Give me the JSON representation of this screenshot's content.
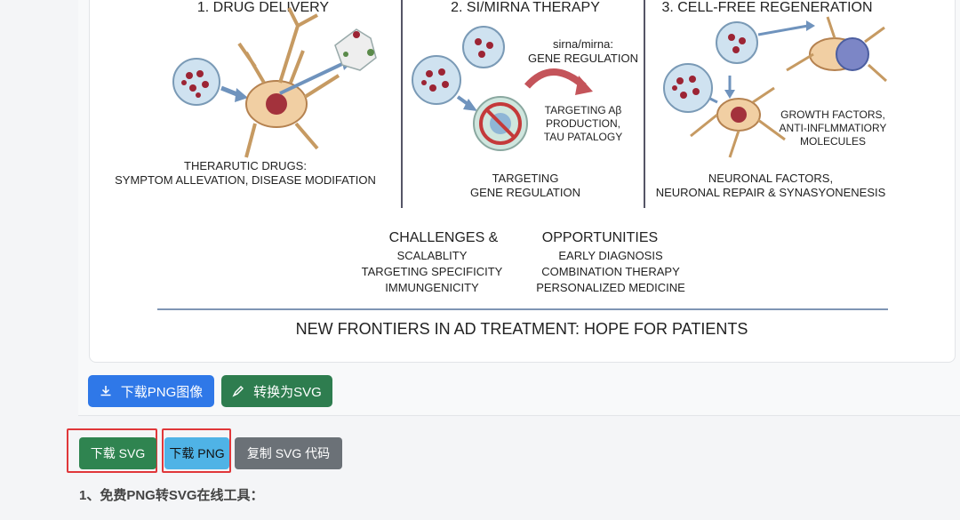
{
  "infographic": {
    "sections": [
      {
        "title": "1. DRUG DELIVERY",
        "caption_line1": "THERARUTIC DRUGS:",
        "caption_line2": "SYMPTOM ALLEVATION, DISEASE MODIFATION"
      },
      {
        "title": "2. SI/MIRNA THERAPY",
        "note_line1": "sirna/mirna:",
        "note_line2": "GENE REGULATION",
        "target_line1": "TARGETING Aβ",
        "target_line2": "PRODUCTION,",
        "target_line3": "TAU PATALOGY",
        "caption_line1": "TARGETING",
        "caption_line2": "GENE REGULATION"
      },
      {
        "title": "3. CELL-FREE REGENERATION",
        "note_line1": "GROWTH FACTORS,",
        "note_line2": "ANTI-INFLMMATIORY",
        "note_line3": "MOLECULES",
        "caption_line1": "NEURONAL FACTORS,",
        "caption_line2": "NEURONAL REPAIR & SYNASYONENESIS"
      }
    ],
    "challenges": {
      "heading": "CHALLENGES &",
      "items": [
        "SCALABLITY",
        "TARGETING SPECIFICITY",
        "IMMUNGENICITY"
      ]
    },
    "opportunities": {
      "heading": "OPPORTUNITIES",
      "items": [
        "EARLY DIAGNOSIS",
        "COMBINATION THERAPY",
        "PERSONALIZED MEDICINE"
      ]
    },
    "footer": "NEW FRONTIERS IN AD TREATMENT: HOPE FOR PATIENTS"
  },
  "toolbar": {
    "download_png_image": "下载PNG图像",
    "convert_to_svg": "转换为SVG",
    "download_icon": "download-icon",
    "pen_icon": "pen-icon"
  },
  "actions": {
    "download_svg": "下载 SVG",
    "download_png": "下载 PNG",
    "copy_svg_code": "复制 SVG 代码"
  },
  "section_heading": "1、免费PNG转SVG在线工具：",
  "colors": {
    "primary_blue": "#2f78e8",
    "green": "#2e7d4f",
    "light_blue": "#4fb3e6",
    "gray": "#6b7177",
    "highlight_red": "#e0373a"
  }
}
